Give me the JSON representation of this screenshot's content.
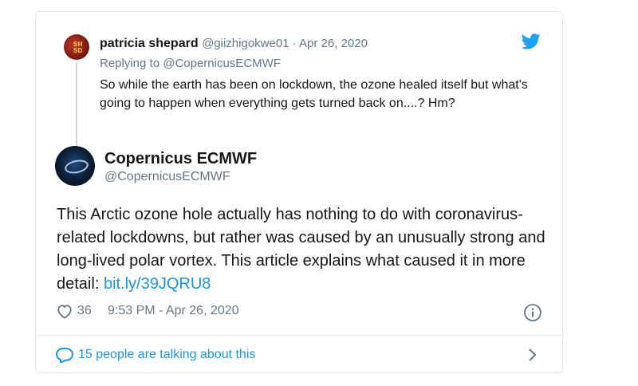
{
  "reply": {
    "name": "patricia shepard",
    "handle": "@giizhigokwe01",
    "separator": " · ",
    "date": "Apr 26, 2020",
    "replying_to": "Replying to @CopernicusECMWF",
    "text": "So while the earth has been on lockdown, the ozone healed itself but what's going to happen when everything gets turned back on....? Hm?",
    "avatar_text": "SH SD"
  },
  "main": {
    "name": "Copernicus ECMWF",
    "handle": "@CopernicusECMWF",
    "text": "This Arctic ozone hole actually has nothing to do with coronavirus-related lockdowns, but rather was caused by an unusually strong and long-lived polar vortex. This article explains what caused it in more detail: ",
    "link": "bit.ly/39JQRU8"
  },
  "footer": {
    "likes": "36",
    "timestamp": "9:53 PM - Apr 26, 2020",
    "talking": "15 people are talking about this"
  },
  "icons": {
    "bird": "twitter-bird-icon",
    "heart": "heart-icon",
    "info": "info-icon",
    "bubble": "speech-bubble-icon",
    "chevron": "chevron-right-icon"
  },
  "colors": {
    "accent": "#1b95e0",
    "secondary_text": "#657786",
    "border": "#e1e8ed"
  }
}
